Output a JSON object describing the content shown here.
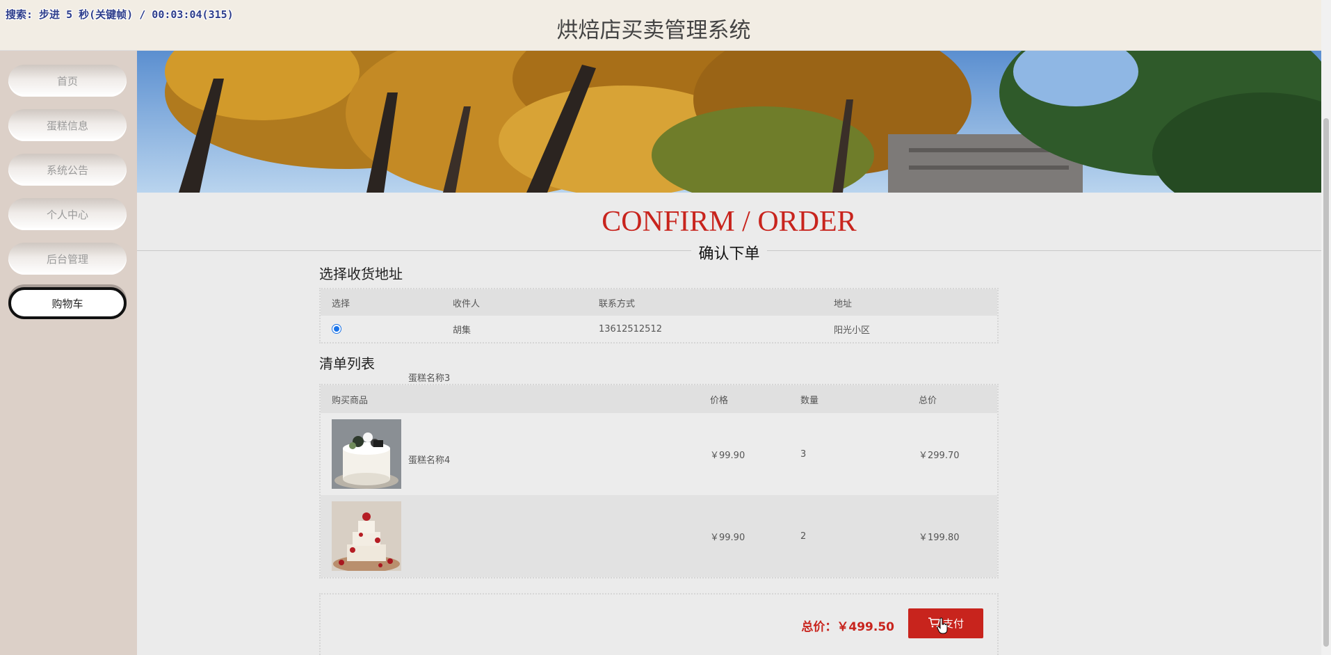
{
  "overlay_text": "搜索: 步进 5 秒(关键帧) / 00:03:04(315)",
  "header": {
    "title": "烘焙店买卖管理系统"
  },
  "sidebar": {
    "items": [
      {
        "label": "首页"
      },
      {
        "label": "蛋糕信息"
      },
      {
        "label": "系统公告"
      },
      {
        "label": "个人中心"
      },
      {
        "label": "后台管理"
      },
      {
        "label": "购物车"
      }
    ],
    "active_index": 5
  },
  "page": {
    "title_en": "CONFIRM / ORDER",
    "title_cn": "确认下单"
  },
  "address": {
    "section_title": "选择收货地址",
    "headers": [
      "选择",
      "收件人",
      "联系方式",
      "地址"
    ],
    "rows": [
      {
        "selected": true,
        "name": "胡集",
        "phone": "13612512512",
        "address": "阳光小区"
      }
    ]
  },
  "cart": {
    "section_title": "清单列表",
    "headers": [
      "购买商品",
      "价格",
      "数量",
      "总价"
    ],
    "items": [
      {
        "name": "蛋糕名称3",
        "price": "￥99.90",
        "qty": "3",
        "subtotal": "￥299.70"
      },
      {
        "name": "蛋糕名称4",
        "price": "￥99.90",
        "qty": "2",
        "subtotal": "￥199.80"
      }
    ]
  },
  "footer": {
    "total_label": "总价：￥499.50",
    "pay_label": "支付"
  },
  "colors": {
    "accent": "#c8241d",
    "radio": "#1a73e8"
  }
}
